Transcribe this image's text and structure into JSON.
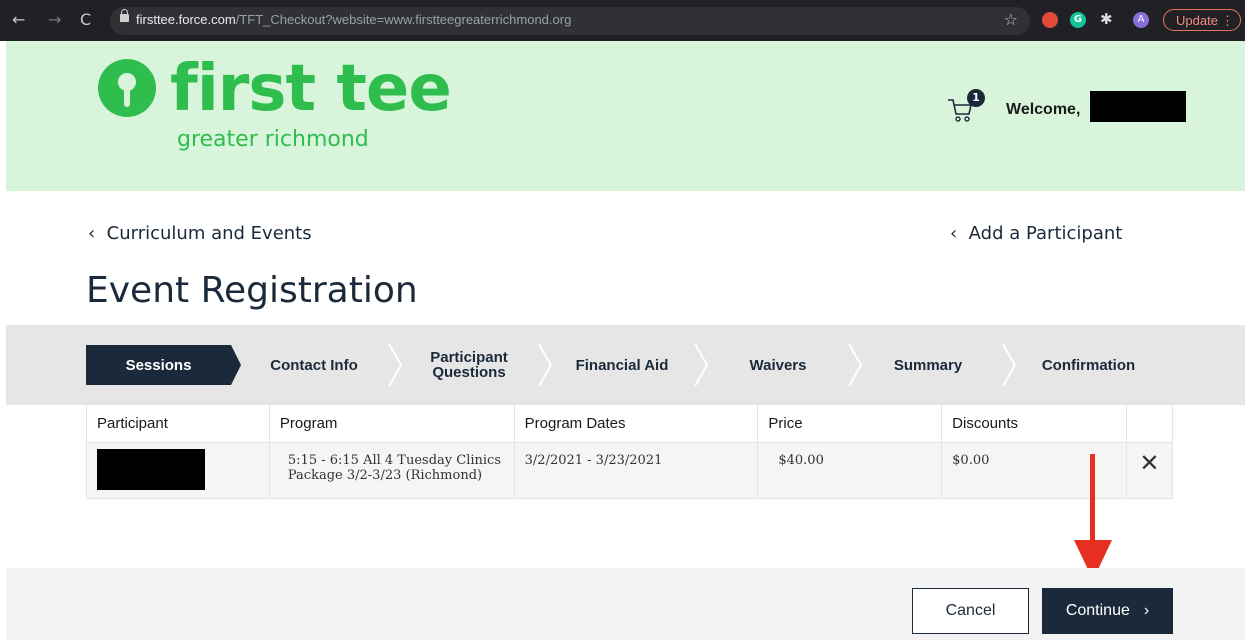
{
  "browser": {
    "url_host": "firsttee.force.com",
    "url_path": "/TFT_Checkout?website=www.firstteegreaterrichmond.org",
    "update_label": "Update",
    "profile_initial": "A",
    "ext_g_letter": "G"
  },
  "header": {
    "logo_word": "first tee",
    "logo_sub": "greater richmond",
    "cart_count": "1",
    "welcome": "Welcome,"
  },
  "nav": {
    "back_left": "Curriculum and Events",
    "back_right": "Add a Participant"
  },
  "page_title": "Event Registration",
  "steps": [
    {
      "label": "Sessions",
      "active": true
    },
    {
      "label": "Contact Info"
    },
    {
      "label": "Participant Questions"
    },
    {
      "label": "Financial Aid"
    },
    {
      "label": "Waivers"
    },
    {
      "label": "Summary"
    },
    {
      "label": "Confirmation"
    }
  ],
  "table": {
    "headers": [
      "Participant",
      "Program",
      "Program Dates",
      "Price",
      "Discounts"
    ],
    "rows": [
      {
        "program": "5:15 - 6:15 All 4 Tuesday Clinics Package 3/2-3/23 (Richmond)",
        "dates": "3/2/2021 - 3/23/2021",
        "price": "$40.00",
        "discounts": "$0.00"
      }
    ]
  },
  "buttons": {
    "cancel": "Cancel",
    "continue": "Continue"
  },
  "colors": {
    "brand_green": "#2fbd4e",
    "header_bg": "#d8f5dc",
    "navy": "#1b2a3a",
    "arrow_red": "#e62e21"
  }
}
